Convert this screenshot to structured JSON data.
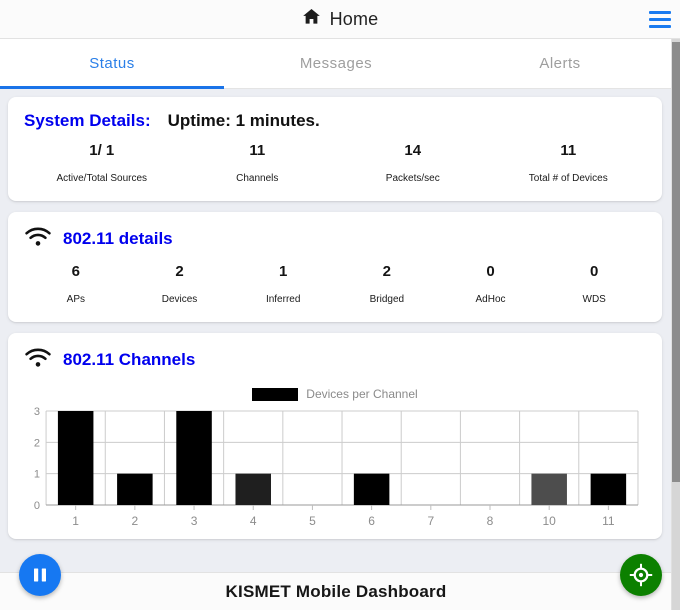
{
  "header": {
    "title": "Home",
    "home_icon": "home-icon",
    "menu_icon": "hamburger-menu-icon"
  },
  "tabs": [
    {
      "label": "Status",
      "active": true
    },
    {
      "label": "Messages",
      "active": false
    },
    {
      "label": "Alerts",
      "active": false
    }
  ],
  "system_details": {
    "title": "System Details:",
    "uptime": "Uptime: 1 minutes.",
    "stats": [
      {
        "value": "1/ 1",
        "label": "Active/Total Sources"
      },
      {
        "value": "11",
        "label": "Channels"
      },
      {
        "value": "14",
        "label": "Packets/sec"
      },
      {
        "value": "11",
        "label": "Total # of Devices"
      }
    ]
  },
  "dot11_details": {
    "title": "802.11 details",
    "icon": "wifi-icon",
    "stats": [
      {
        "value": "6",
        "label": "APs"
      },
      {
        "value": "2",
        "label": "Devices"
      },
      {
        "value": "1",
        "label": "Inferred"
      },
      {
        "value": "2",
        "label": "Bridged"
      },
      {
        "value": "0",
        "label": "AdHoc"
      },
      {
        "value": "0",
        "label": "WDS"
      }
    ]
  },
  "dot11_channels": {
    "title": "802.11 Channels",
    "icon": "wifi-icon"
  },
  "chart_data": {
    "type": "bar",
    "title": "802.11 Channels",
    "legend": [
      {
        "name": "Devices per Channel",
        "color": "#000000"
      }
    ],
    "legend_position": "top-center",
    "categories": [
      "1",
      "2",
      "3",
      "4",
      "5",
      "6",
      "7",
      "8",
      "10",
      "11"
    ],
    "values": [
      3,
      1,
      3,
      1,
      0,
      1,
      0,
      0,
      1,
      1
    ],
    "bar_colors": [
      "#000000",
      "#000000",
      "#000000",
      "#1f1f1f",
      "#000000",
      "#000000",
      "#000000",
      "#000000",
      "#4d4d4d",
      "#000000"
    ],
    "xlabel": "",
    "ylabel": "",
    "ylim": [
      0,
      3
    ],
    "yticks": [
      0,
      1,
      2,
      3
    ],
    "grid": true
  },
  "footer": {
    "title": "KISMET Mobile Dashboard"
  },
  "fabs": [
    {
      "name": "pause-button",
      "icon": "pause-icon",
      "color": "#1678f2"
    },
    {
      "name": "locate-button",
      "icon": "crosshair-target-icon",
      "color": "#0c8000"
    }
  ],
  "colors": {
    "accent": "#1a73e8",
    "link": "#0000ee",
    "page_bg": "#eceef3",
    "tab_inactive": "#9e9e9e"
  }
}
